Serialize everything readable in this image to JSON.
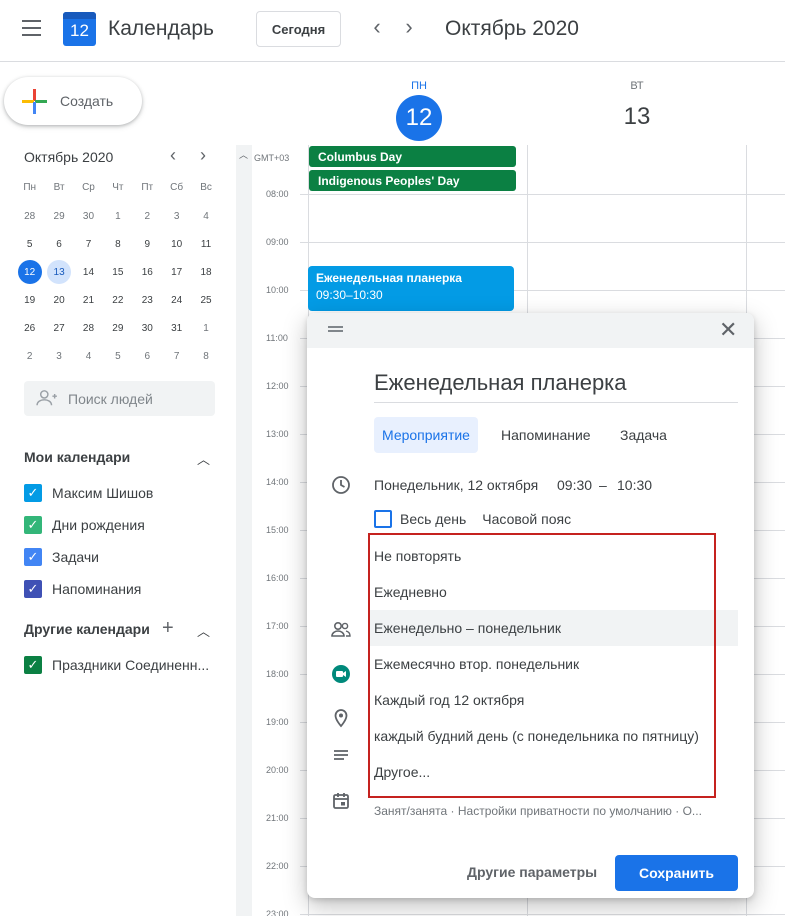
{
  "header": {
    "app_title": "Календарь",
    "logo_day": "12",
    "today_label": "Сегодня",
    "prev_label": "‹",
    "next_label": "›",
    "month_title": "Октябрь 2020"
  },
  "sidebar": {
    "create_label": "Создать",
    "mini_calendar": {
      "title": "Октябрь 2020",
      "prev": "‹",
      "next": "›",
      "weekdays": [
        "Пн",
        "Вт",
        "Ср",
        "Чт",
        "Пт",
        "Сб",
        "Вс"
      ],
      "weeks": [
        [
          "28",
          "29",
          "30",
          "1",
          "2",
          "3",
          "4"
        ],
        [
          "5",
          "6",
          "7",
          "8",
          "9",
          "10",
          "11"
        ],
        [
          "12",
          "13",
          "14",
          "15",
          "16",
          "17",
          "18"
        ],
        [
          "19",
          "20",
          "21",
          "22",
          "23",
          "24",
          "25"
        ],
        [
          "26",
          "27",
          "28",
          "29",
          "30",
          "31",
          "1"
        ],
        [
          "2",
          "3",
          "4",
          "5",
          "6",
          "7",
          "8"
        ]
      ]
    },
    "people_search_placeholder": "Поиск людей",
    "my_calendars": {
      "title": "Мои календари",
      "items": [
        {
          "label": "Максим Шишов",
          "color": "#039be5"
        },
        {
          "label": "Дни рождения",
          "color": "#33b679"
        },
        {
          "label": "Задачи",
          "color": "#4285f4"
        },
        {
          "label": "Напоминания",
          "color": "#3f51b5"
        }
      ]
    },
    "other_calendars": {
      "title": "Другие календари",
      "items": [
        {
          "label": "Праздники Соединенн...",
          "color": "#0b8043"
        }
      ]
    }
  },
  "grid": {
    "days": [
      {
        "name": "ПН",
        "num": "12"
      },
      {
        "name": "ВТ",
        "num": "13"
      }
    ],
    "timezone": "GMT+03",
    "allday_events": [
      "Columbus Day",
      "Indigenous Peoples' Day"
    ],
    "times": [
      "08:00",
      "09:00",
      "10:00",
      "11:00",
      "12:00",
      "13:00",
      "14:00",
      "15:00",
      "16:00",
      "17:00",
      "18:00",
      "19:00",
      "20:00",
      "21:00",
      "22:00",
      "23:00"
    ],
    "event": {
      "title": "Еженедельная планерка",
      "time": "09:30–10:30"
    }
  },
  "dialog": {
    "title": "Еженедельная планерка",
    "tabs": [
      "Мероприятие",
      "Напоминание",
      "Задача"
    ],
    "date": "Понедельник, 12 октября",
    "start": "09:30",
    "dash": "–",
    "end": "10:30",
    "allday_label": "Весь день",
    "timezone_label": "Часовой пояс",
    "footer_text": "Занят/занята · Настройки приватности по умолчанию · О...",
    "more_options": "Другие параметры",
    "save": "Сохранить"
  },
  "repeat_menu": {
    "items": [
      "Не повторять",
      "Ежедневно",
      "Еженедельно – понедельник",
      "Ежемесячно втор. понедельник",
      "Каждый год 12 октября",
      "каждый будний день (с понедельника по пятницу)",
      "Другое..."
    ],
    "highlighted_index": 2,
    "border_color": "#c5221f"
  },
  "colors": {
    "accent": "#1a73e8",
    "event": "#039be5",
    "holiday": "#0b8043"
  }
}
